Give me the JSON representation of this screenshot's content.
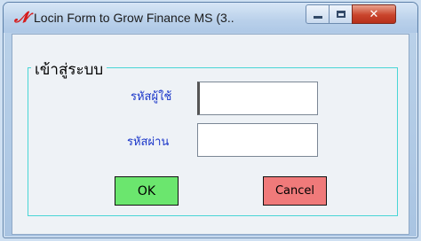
{
  "window": {
    "title": "Locin Form to Grow Finance MS (3..",
    "app_icon": "𝓝",
    "minimize_icon": "minimize-icon",
    "maximize_icon": "maximize-icon",
    "close_label": "✕"
  },
  "form": {
    "group_title": "เข้าสู่ระบบ",
    "user_label": "รหัสผู้ใช้",
    "password_label": "รหัสผ่าน",
    "user_value": "",
    "password_value": "",
    "ok_label": "OK",
    "cancel_label": "Cancel"
  },
  "colors": {
    "ok_button": "#6be66e",
    "cancel_button": "#f07a7a",
    "label_text": "#1a36c9",
    "group_border": "#49d6d6"
  }
}
